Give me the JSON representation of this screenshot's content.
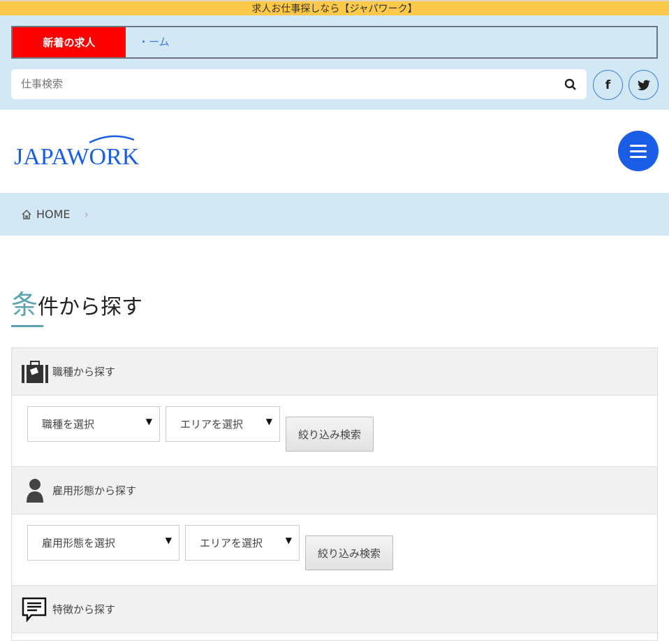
{
  "topbar": {
    "text": "求人お仕事探しなら【ジャパワーク】"
  },
  "ticker": {
    "label": "新着の求人",
    "text": "・ーム"
  },
  "search": {
    "placeholder": "仕事検索"
  },
  "social": {
    "facebook": "f",
    "twitter": "twitter"
  },
  "logo": {
    "text": "JAPAWORK"
  },
  "breadcrumb": {
    "home": "HOME",
    "sep": "›"
  },
  "heading": {
    "first": "条",
    "rest": "件から探す"
  },
  "sections": [
    {
      "title": "職種から探す",
      "select1": "職種を選択",
      "select2": "エリアを選択",
      "button": "絞り込み検索"
    },
    {
      "title": "雇用形態から探す",
      "select1": "雇用形態を選択",
      "select2": "エリアを選択",
      "button": "絞り込み検索"
    },
    {
      "title": "特徴から探す"
    }
  ],
  "colors": {
    "accent": "#1a5ee8",
    "topbar": "#fdc94a",
    "teal": "#5aa3b0",
    "red": "#ff0000"
  }
}
